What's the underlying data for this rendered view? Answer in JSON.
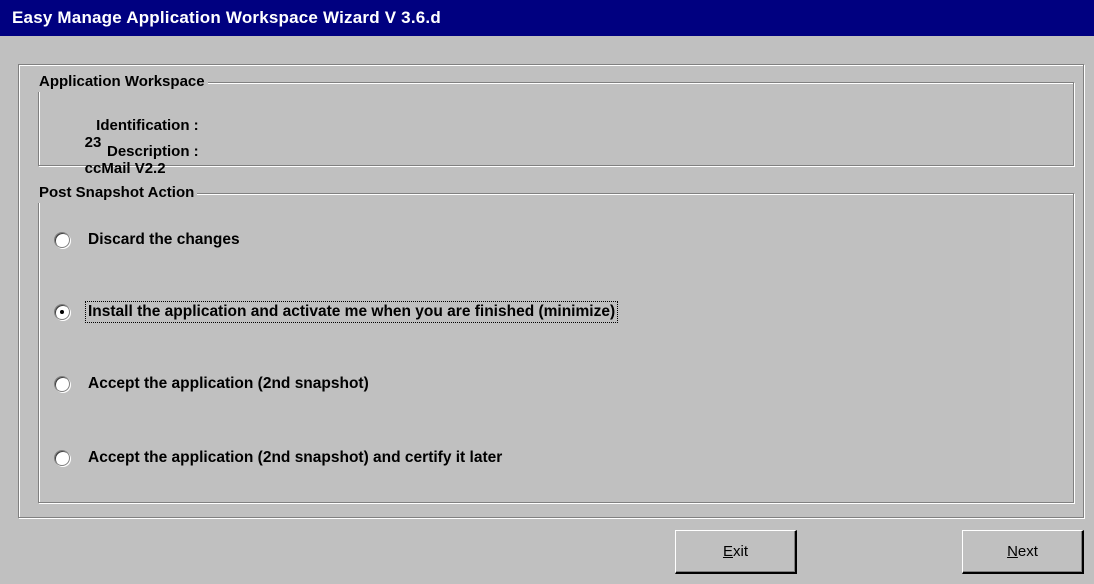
{
  "window": {
    "title": "Easy Manage Application Workspace Wizard V 3.6.d",
    "titlebar_color": "#000080",
    "background_color": "#c0c0c0"
  },
  "workspace_group": {
    "legend": "Application Workspace",
    "identification_label": "Identification :",
    "identification_value": "23",
    "description_label": "Description :",
    "description_value": "ccMail V2.2"
  },
  "snapshot_group": {
    "legend": "Post Snapshot Action",
    "options": [
      {
        "label": "Discard the changes",
        "selected": false
      },
      {
        "label": "Install the application and activate me when you are finished (minimize)",
        "selected": true
      },
      {
        "label": "Accept the application (2nd snapshot)",
        "selected": false
      },
      {
        "label": "Accept the application (2nd snapshot) and certify it later",
        "selected": false
      }
    ]
  },
  "buttons": {
    "exit_mnemonic": "E",
    "exit_rest": "xit",
    "next_mnemonic": "N",
    "next_rest": "ext"
  }
}
